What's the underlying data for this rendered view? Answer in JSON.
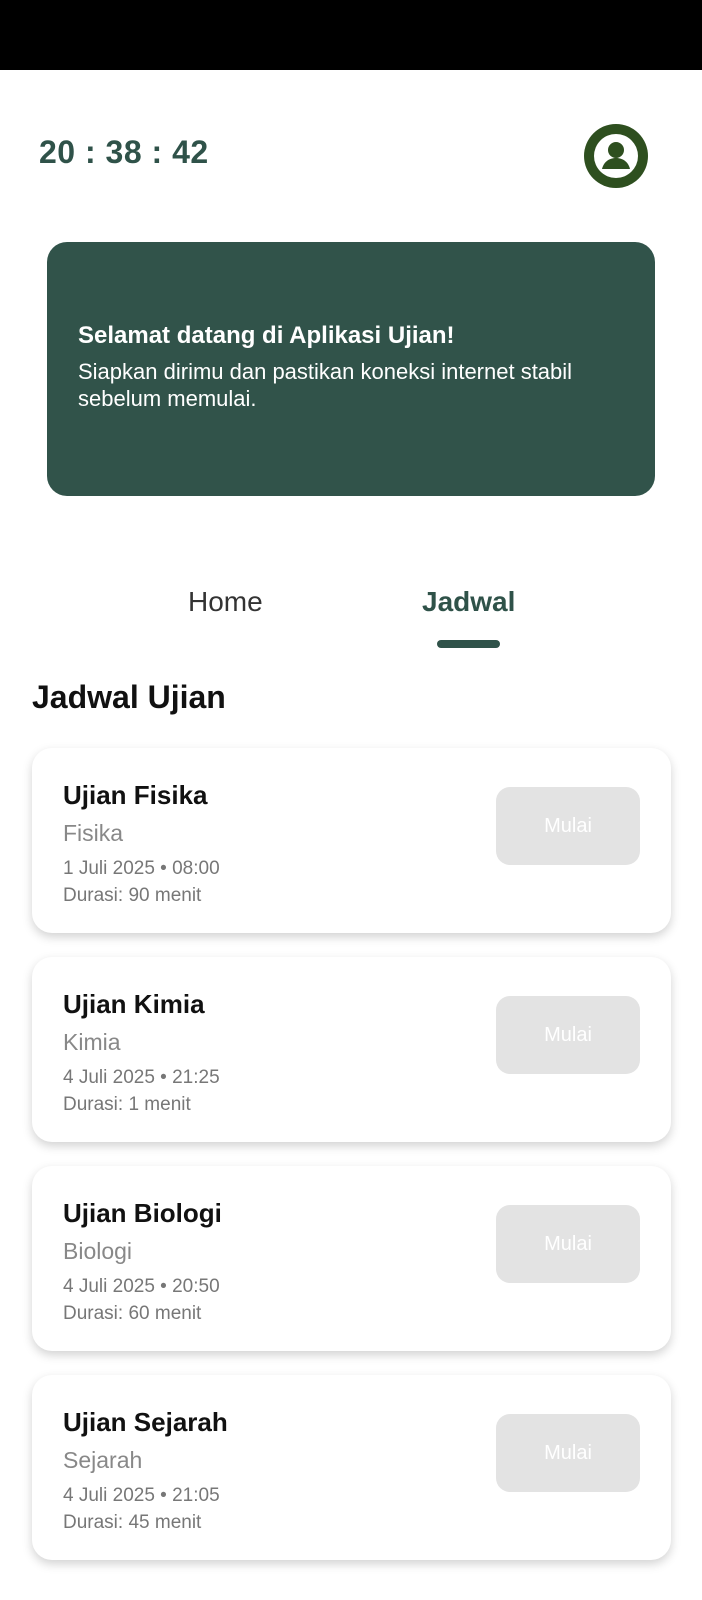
{
  "header": {
    "clock": "20 : 38 : 42",
    "avatar_icon": "user-profile-icon",
    "avatar_color": "#2e4f1f"
  },
  "banner": {
    "title": "Selamat datang di Aplikasi Ujian!",
    "text": "Siapkan dirimu dan pastikan koneksi internet stabil sebelum memulai.",
    "background": "#31534a"
  },
  "tabs": {
    "items": [
      {
        "label": "Home",
        "active": false
      },
      {
        "label": "Jadwal",
        "active": true
      }
    ],
    "accent": "#2f5249"
  },
  "section": {
    "title": "Jadwal Ujian"
  },
  "exams": [
    {
      "title": "Ujian Fisika",
      "subject": "Fisika",
      "datetime": "1 Juli 2025 • 08:00",
      "duration": "Durasi: 90 menit",
      "button": "Mulai"
    },
    {
      "title": "Ujian Kimia",
      "subject": "Kimia",
      "datetime": "4 Juli 2025 • 21:25",
      "duration": "Durasi: 1 menit",
      "button": "Mulai"
    },
    {
      "title": "Ujian Biologi",
      "subject": "Biologi",
      "datetime": "4 Juli 2025 • 20:50",
      "duration": "Durasi: 60 menit",
      "button": "Mulai"
    },
    {
      "title": "Ujian Sejarah",
      "subject": "Sejarah",
      "datetime": "4 Juli 2025 • 21:05",
      "duration": "Durasi: 45 menit",
      "button": "Mulai"
    }
  ]
}
